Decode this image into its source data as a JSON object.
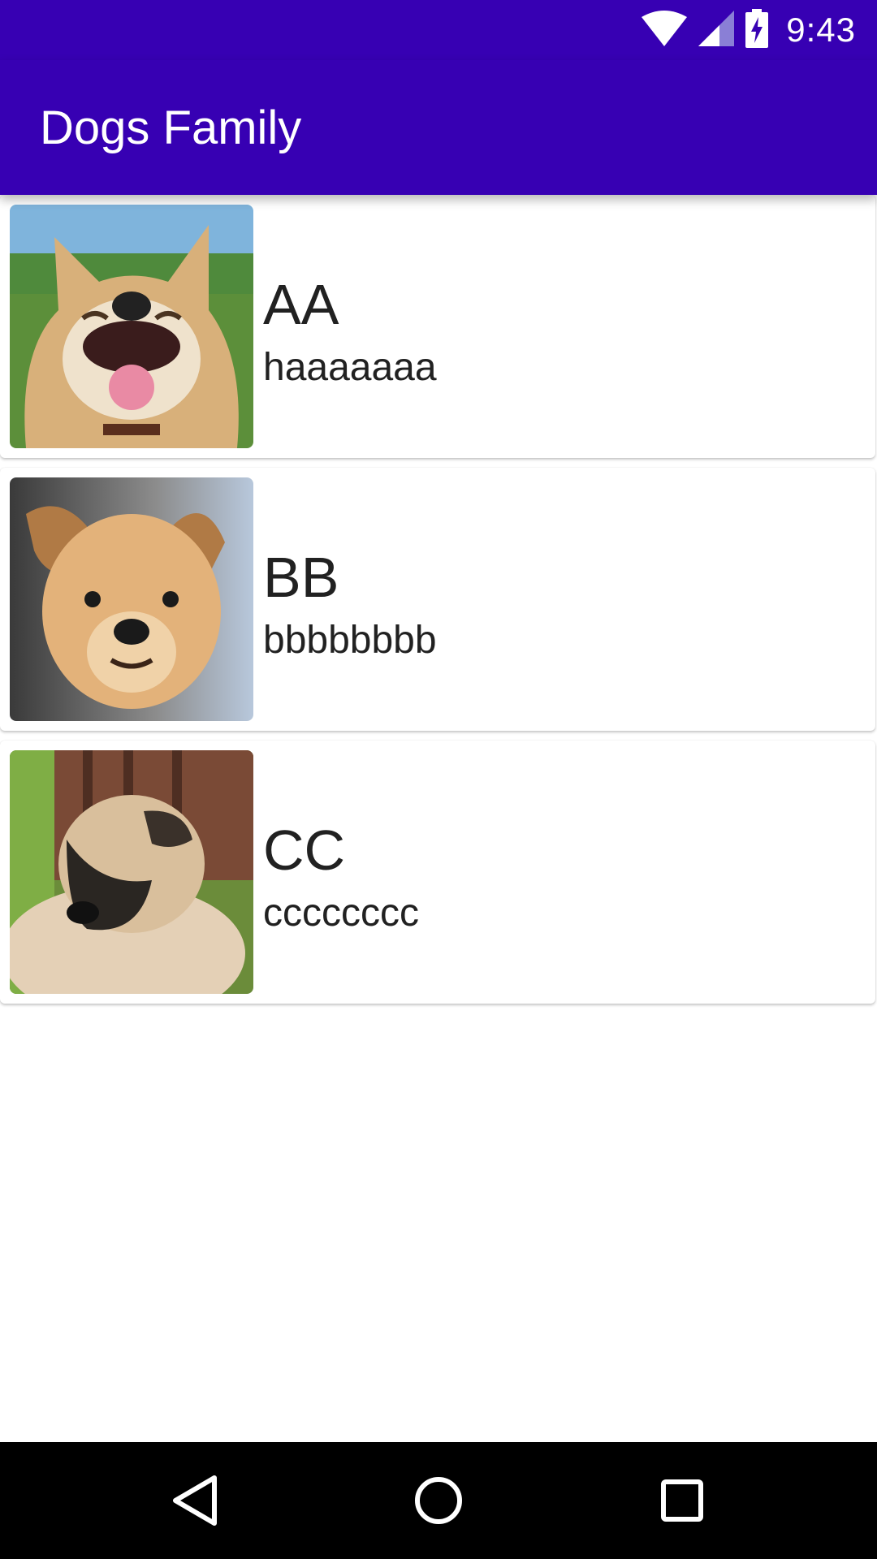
{
  "status_bar": {
    "time": "9:43",
    "icons": [
      "wifi-icon",
      "signal-icon",
      "battery-charging-icon"
    ]
  },
  "app_bar": {
    "title": "Dogs Family",
    "color": "#3700b3"
  },
  "dogs": [
    {
      "name": "AA",
      "description": "haaaaaaa",
      "image": "smiling-shiba-dog-photo"
    },
    {
      "name": "BB",
      "description": "bbbbbbbb",
      "image": "tan-puppy-photo"
    },
    {
      "name": "CC",
      "description": "cccccccc",
      "image": "fluffy-puppy-photo"
    }
  ],
  "nav_bar": {
    "buttons": [
      "back-icon",
      "home-icon",
      "recents-icon"
    ]
  }
}
